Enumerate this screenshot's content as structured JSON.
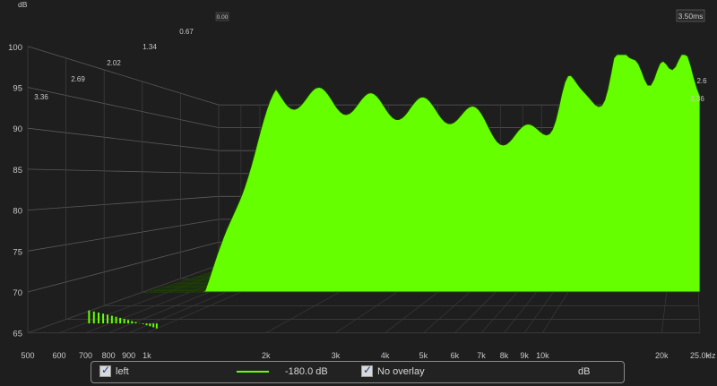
{
  "chart_data": {
    "type": "waterfall",
    "y_unit_label": "dB",
    "x_unit_label": "Hz",
    "time_unit_label": "3.50ms",
    "y_ticks": [
      "100",
      "95",
      "90",
      "85",
      "80",
      "75",
      "70",
      "65"
    ],
    "x_ticks": [
      "500",
      "600",
      "700",
      "800",
      "900",
      "1k",
      "2k",
      "3k",
      "4k",
      "5k",
      "6k",
      "7k",
      "8k",
      "9k",
      "10k",
      "20k",
      "25.0k"
    ],
    "time_ticks_left": [
      "0.00",
      "0.67",
      "1.34",
      "2.02",
      "2.69",
      "3.36"
    ],
    "time_ticks_right": [
      "2.6",
      "3.36"
    ],
    "y_range": [
      65,
      100
    ],
    "x_range_hz": [
      500,
      25000
    ],
    "time_range_ms": [
      0,
      3.5
    ],
    "series_color": "#66ff00",
    "grid": true
  },
  "legend": {
    "channel_label": "left",
    "level": "-180.0 dB",
    "overlay_label": "No overlay",
    "unit_label": "dB"
  }
}
